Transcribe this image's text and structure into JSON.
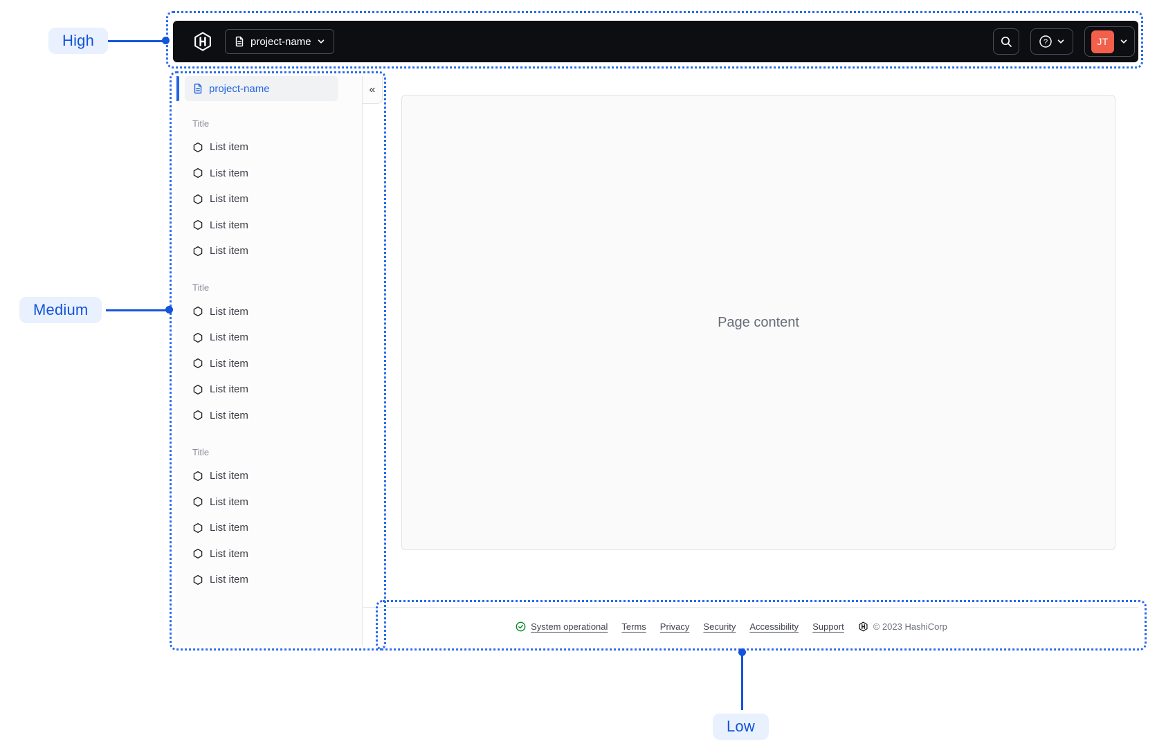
{
  "annotations": {
    "high": {
      "label": "High"
    },
    "medium": {
      "label": "Medium"
    },
    "low": {
      "label": "Low"
    }
  },
  "navbar": {
    "project_switcher": {
      "label": "project-name"
    },
    "user": {
      "initials": "JT"
    }
  },
  "sidebar": {
    "active_item": {
      "label": "project-name"
    },
    "sections": [
      {
        "title": "Title",
        "items": [
          "List item",
          "List item",
          "List item",
          "List item",
          "List item"
        ]
      },
      {
        "title": "Title",
        "items": [
          "List item",
          "List item",
          "List item",
          "List item",
          "List item"
        ]
      },
      {
        "title": "Title",
        "items": [
          "List item",
          "List item",
          "List item",
          "List item",
          "List item"
        ]
      }
    ]
  },
  "main": {
    "placeholder": "Page content"
  },
  "footer": {
    "status": {
      "label": "System operational"
    },
    "links": [
      "Terms",
      "Privacy",
      "Security",
      "Accessibility",
      "Support"
    ],
    "copyright": "© 2023 HashiCorp"
  },
  "icons": {
    "collapse": "«"
  },
  "colors": {
    "navbar_bg": "#0D0E12",
    "navbar_border": "#494E57",
    "avatar_orange": "#F25F4A",
    "accent_blue": "#2264E4",
    "annotation_blue": "#1254DB",
    "annotation_border_blue": "#2A6AF2",
    "annotation_pill_bg": "#E9F0FE",
    "success_green": "#008A22",
    "card_bg": "#FAFAFA",
    "border_gray": "#E3E4E8",
    "text_primary": "#3B3D45",
    "text_muted": "#8B8E98",
    "footer_text": "#42454C",
    "copyright_text": "#6E727B",
    "placeholder_text": "#656C79"
  }
}
